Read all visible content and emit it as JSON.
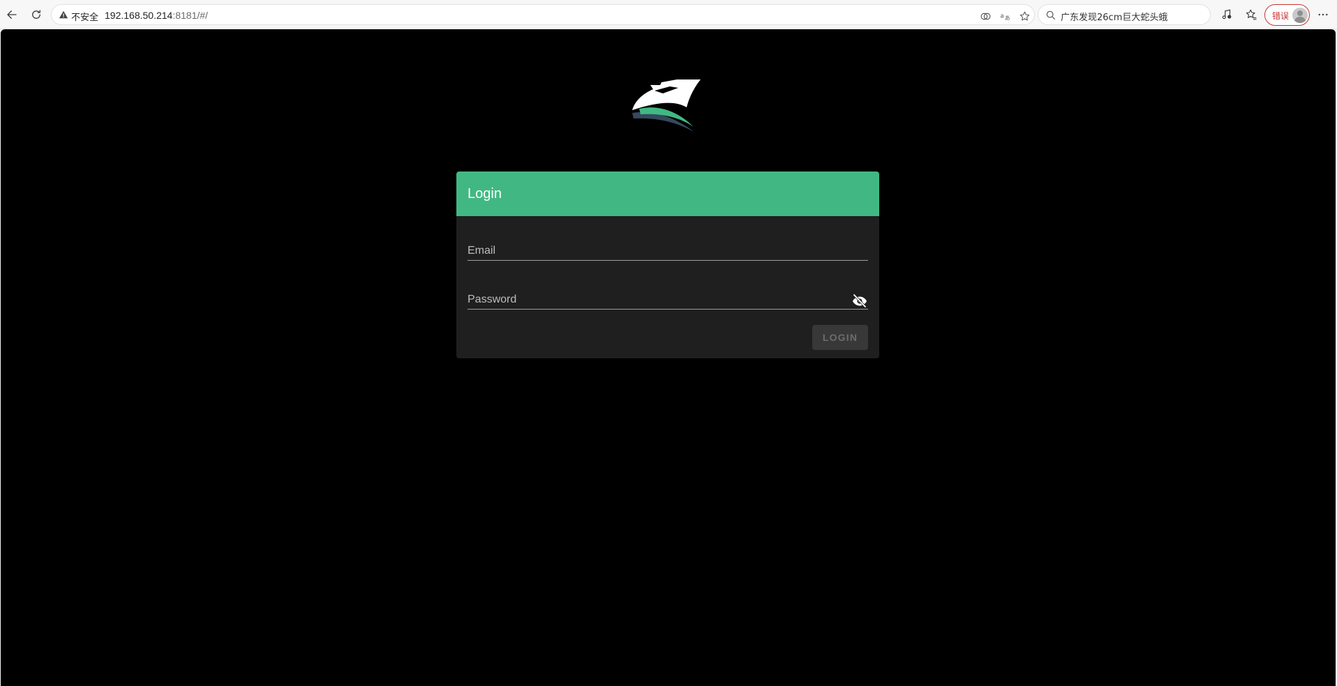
{
  "browser": {
    "address": {
      "security_label": "不安全",
      "host": "192.168.50.214",
      "path": ":8181/#/"
    },
    "search_text": "广东发现26cm巨大蛇头蛾",
    "profile_status": "错误"
  },
  "page": {
    "background": "#000000",
    "accent_color": "#41b883",
    "login_card": {
      "title": "Login",
      "email_label": "Email",
      "password_label": "Password",
      "submit_label": "LOGIN"
    }
  }
}
